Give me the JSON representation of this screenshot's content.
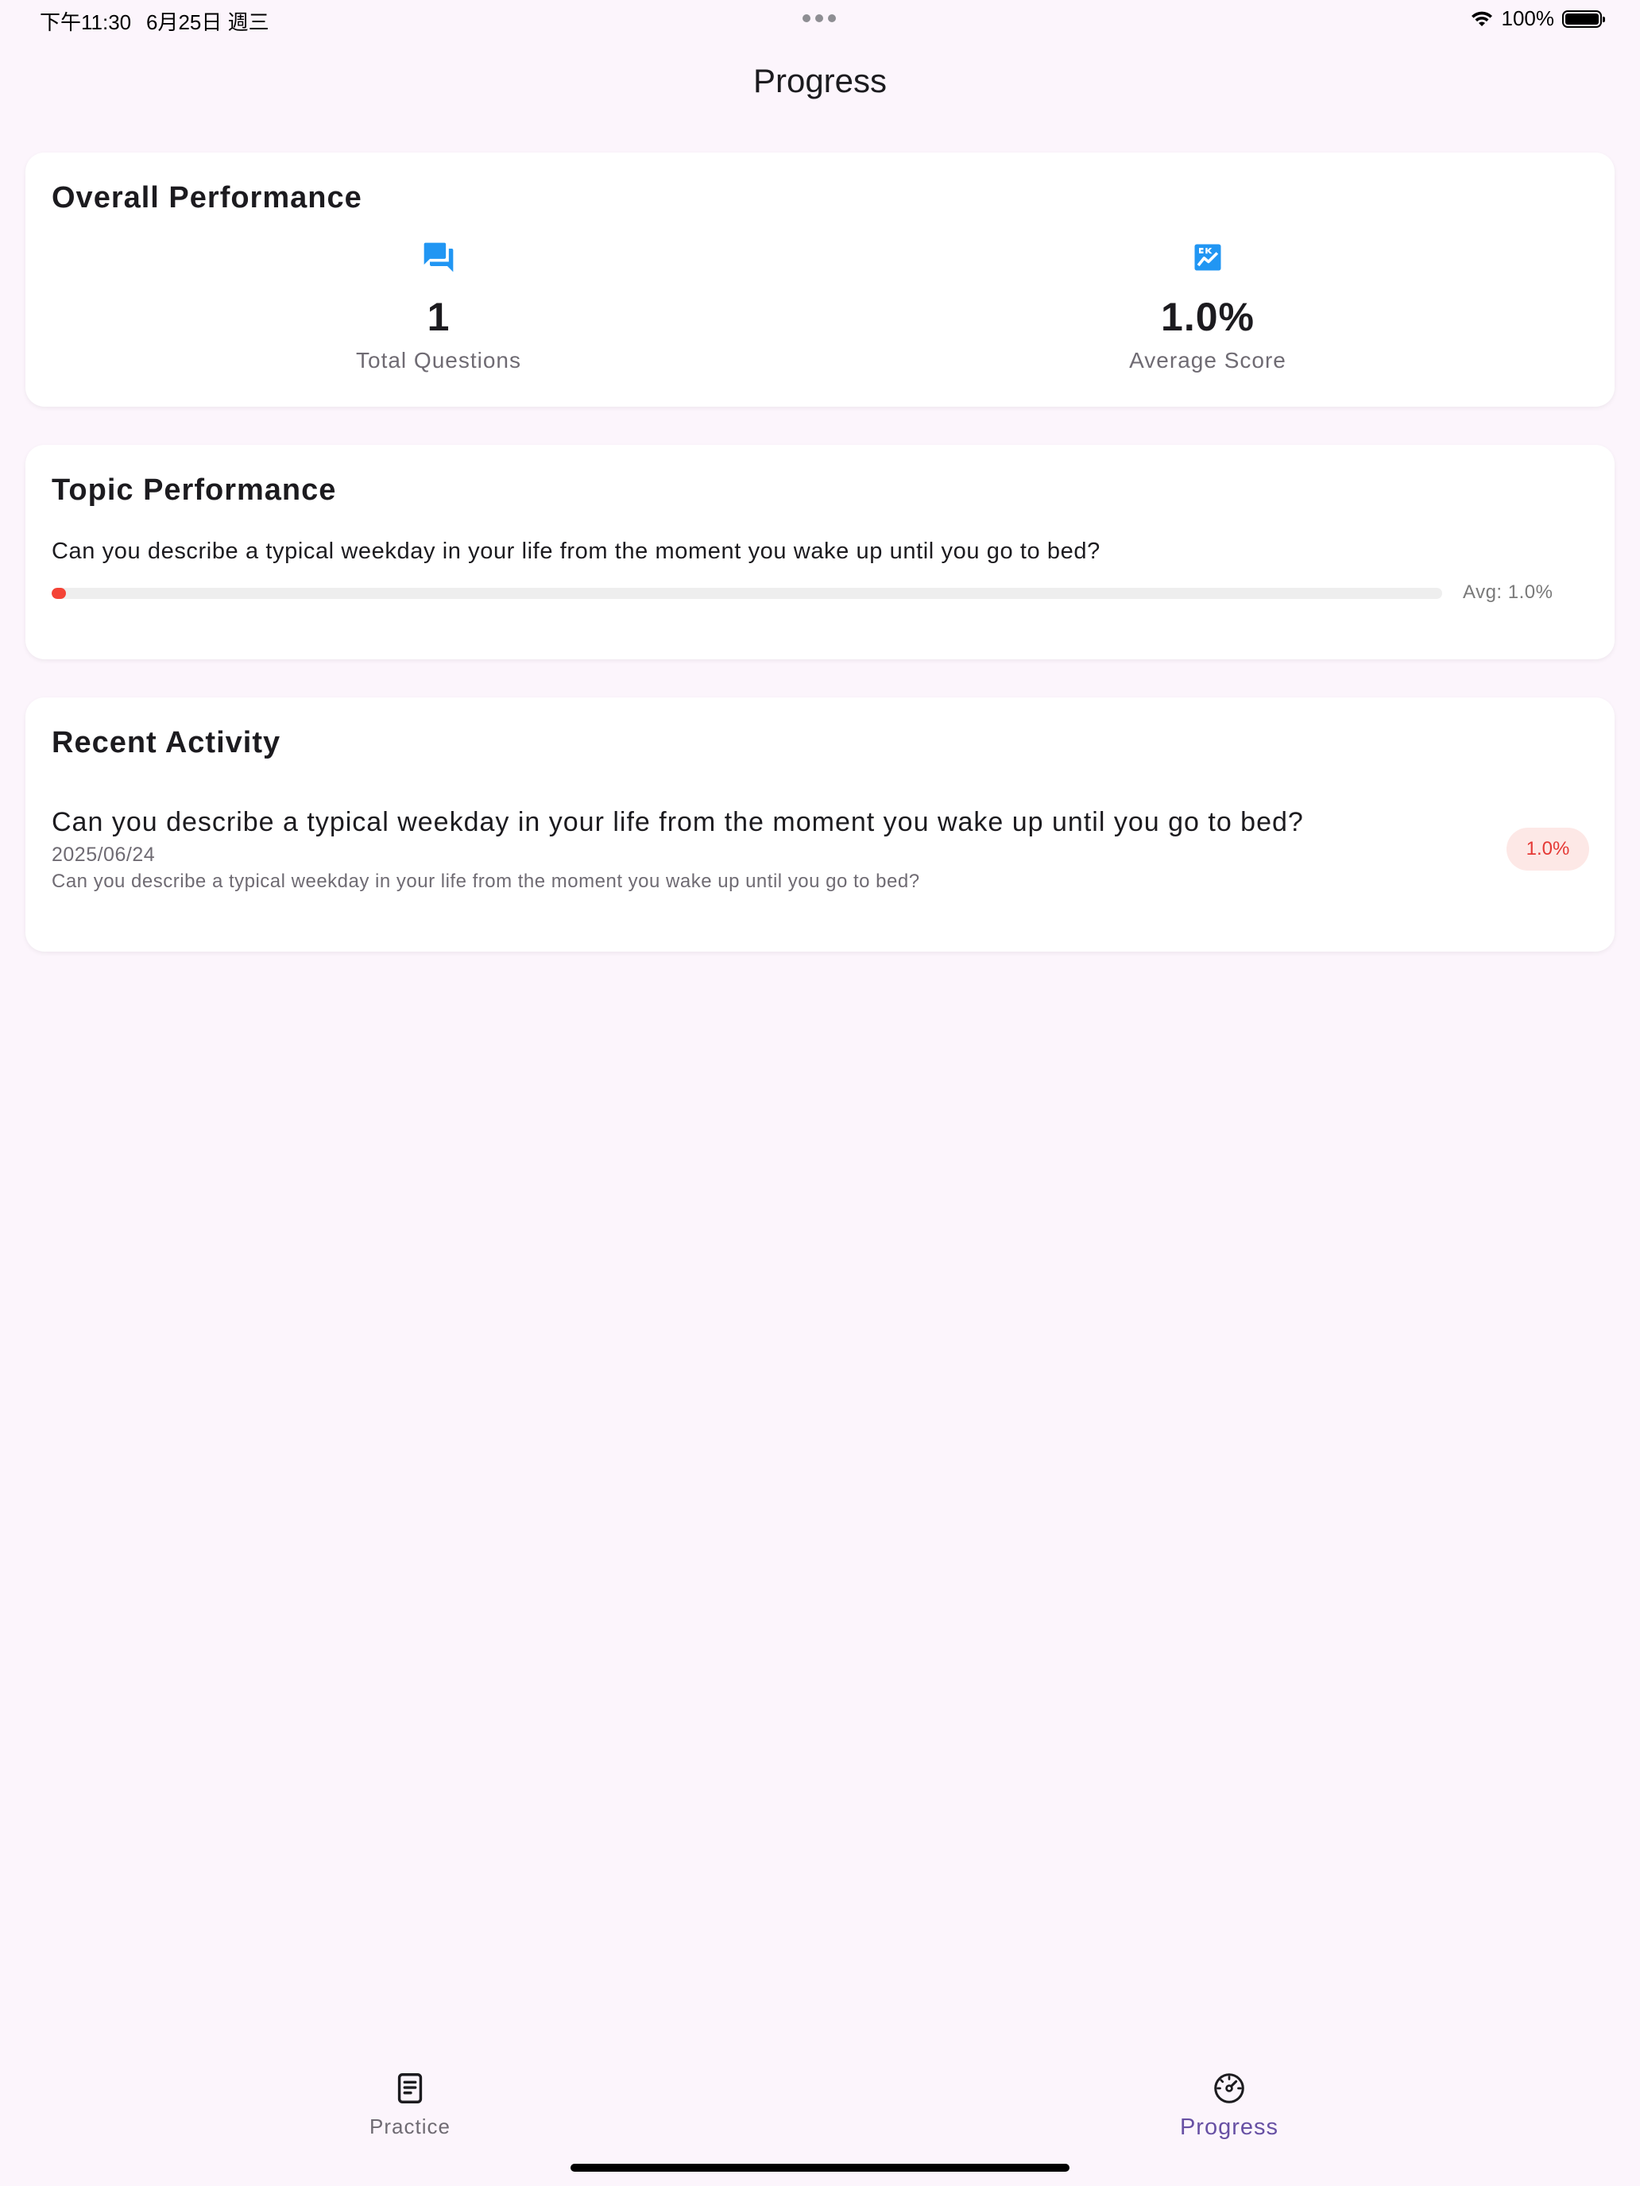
{
  "status_bar": {
    "time": "下午11:30",
    "date": "6月25日 週三",
    "battery": "100%"
  },
  "app_bar": {
    "title": "Progress"
  },
  "overall": {
    "title": "Overall Performance",
    "total_questions": {
      "value": "1",
      "label": "Total Questions",
      "icon": "forum-icon"
    },
    "average_score": {
      "value": "1.0%",
      "label": "Average Score",
      "icon": "score-chart-icon"
    }
  },
  "topic": {
    "title": "Topic Performance",
    "items": [
      {
        "question": "Can you describe a typical weekday in your life from the moment you wake up until you go to bed?",
        "avg_label": "Avg: 1.0%",
        "avg_percent": 1.0
      }
    ]
  },
  "recent": {
    "title": "Recent Activity",
    "items": [
      {
        "title": "Can you describe a typical weekday in your life from the moment you wake up until you go to bed?",
        "date": "2025/06/24",
        "description": "Can you describe a typical weekday in your life from the moment you wake up until you go to bed?",
        "score": "1.0%"
      }
    ]
  },
  "nav": {
    "practice_label": "Practice",
    "progress_label": "Progress",
    "active": "progress"
  },
  "colors": {
    "background": "#fcf5fc",
    "accent_blue": "#2196f3",
    "low_score_red": "#f44336",
    "badge_bg": "#fde8e6",
    "nav_active": "#6750a4"
  }
}
